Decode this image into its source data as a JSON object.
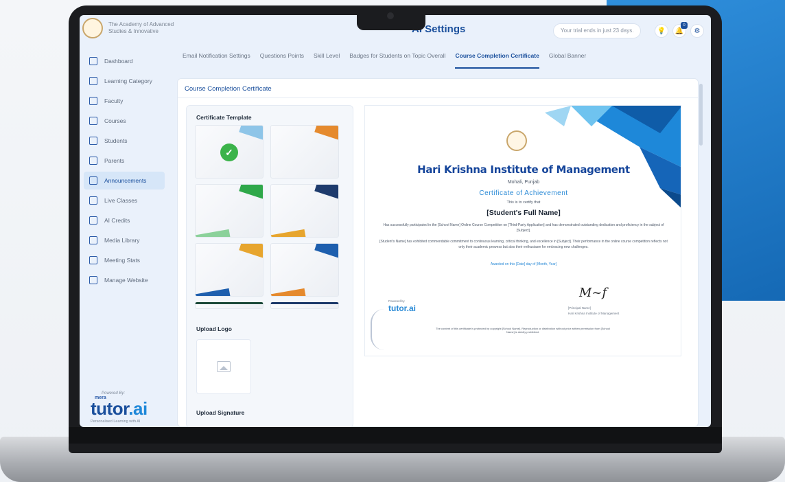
{
  "header": {
    "institute_name": "The Academy of Advanced Studies & Innovative",
    "page_title": "AI Settings",
    "trial_text": "Your trial ends in just 23 days.",
    "notification_count": "0"
  },
  "sidebar": {
    "items": [
      {
        "label": "Dashboard",
        "icon": "dashboard-icon"
      },
      {
        "label": "Learning Category",
        "icon": "category-icon"
      },
      {
        "label": "Faculty",
        "icon": "faculty-icon"
      },
      {
        "label": "Courses",
        "icon": "courses-icon"
      },
      {
        "label": "Students",
        "icon": "students-icon"
      },
      {
        "label": "Parents",
        "icon": "parents-icon"
      },
      {
        "label": "Announcements",
        "icon": "megaphone-icon"
      },
      {
        "label": "Live Classes",
        "icon": "live-icon"
      },
      {
        "label": "AI Credits",
        "icon": "credits-icon"
      },
      {
        "label": "Media Library",
        "icon": "media-icon"
      },
      {
        "label": "Meeting Stats",
        "icon": "stats-icon"
      },
      {
        "label": "Manage Website",
        "icon": "website-icon"
      }
    ],
    "active_index": 6,
    "powered_by": "Powered By:",
    "brand_prefix": "mera",
    "brand_main": "tutor",
    "brand_suffix": ".ai",
    "brand_tagline": "Personalised Learning with AI"
  },
  "tabs": [
    {
      "label": "Email Notification Settings",
      "active": false
    },
    {
      "label": "Questions Points",
      "active": false
    },
    {
      "label": "Skill Level",
      "active": false
    },
    {
      "label": "Badges for Students on Topic Overall",
      "active": false
    },
    {
      "label": "Course Completion Certificate",
      "active": true
    },
    {
      "label": "Global Banner",
      "active": false
    }
  ],
  "panel": {
    "title": "Course Completion Certificate",
    "certificate_template_label": "Certificate Template",
    "upload_logo_label": "Upload Logo",
    "upload_signature_label": "Upload Signature"
  },
  "certificate": {
    "institute": "Hari Krishna Institute of Management",
    "location": "Mohali, Punjab",
    "title": "Certificate of Achievement",
    "certify": "This is to certify that",
    "student": "[Student's Full Name]",
    "body1": "Has successfully participated in the [School Name] Online Course Competition on [Third-Party Application] and has demonstrated outstanding dedication and proficiency in the subject of [Subject].",
    "body2": "[Student's Name] has exhibited commendable commitment to continuous learning, critical thinking, and excellence in [Subject]. Their performance in the online course competition reflects not only their academic prowess but also their enthusiasm for embracing new challenges.",
    "awarded": "Awarded on this [Date] day of [Month, Year]",
    "signatory": "[Principal Name]",
    "signatory_org": "Hari Krishna Institute of Management",
    "footer": "The content of this certificate is protected by copyright [School Name]. Reproduction or distribution without prior written permission from [School Name] is strictly prohibited.",
    "powered_by": "Powered by",
    "brand": "tutor.ai"
  }
}
